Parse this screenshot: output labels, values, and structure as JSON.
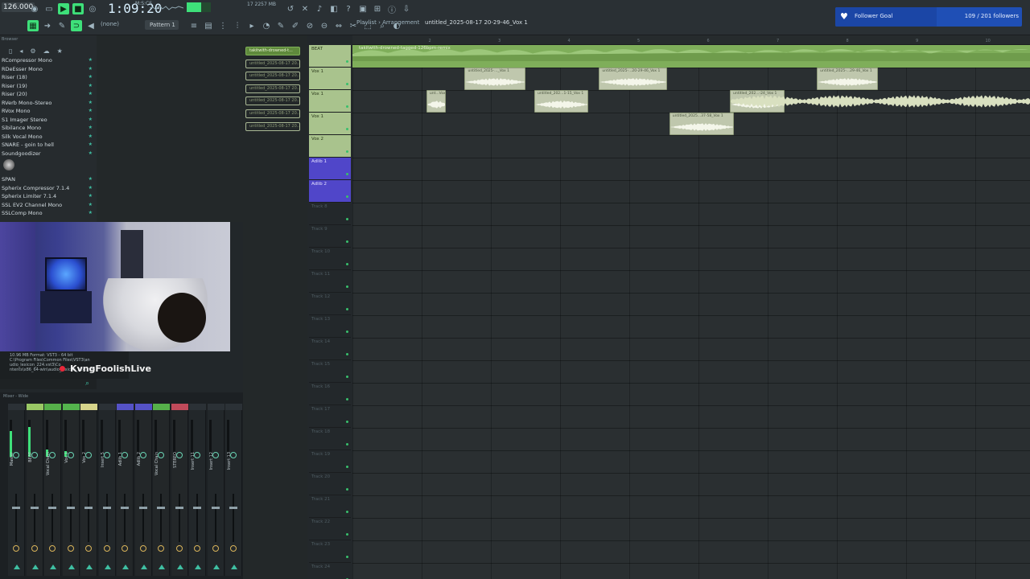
{
  "toolbar": {
    "bpm": "126.000",
    "song_time": "1:09:20",
    "time_unit": "M:S:CS",
    "memory": "17   2257 MB",
    "snap": "(none)",
    "pattern": "Pattern 1"
  },
  "playlist": {
    "label": "Playlist",
    "section": "Arrangement",
    "title": "untitled_2025-08-17 20-29-46_Vox 1",
    "ruler": [
      "2",
      "3",
      "4",
      "5",
      "6",
      "7",
      "8",
      "9",
      "10",
      "11"
    ]
  },
  "follower_goal": {
    "label": "Follower Goal",
    "count": "109 / 201 followers",
    "progress": 0.542,
    "color": "#1f4fb5"
  },
  "browser": {
    "header": "Browser",
    "plugins": [
      "RCompressor Mono",
      "RDeEsser Mono",
      "Riser (18)",
      "Riser (19)",
      "Riser (20)",
      "RVerb Mono-Stereo",
      "RVox Mono",
      "S1 Imager Stereo",
      "Sibilance Mono",
      "Silk Vocal Mono",
      "SNARE - goin to hell",
      "Soundgoodizer"
    ],
    "plugins2": [
      "SPAN",
      "Spherix Compressor 7.1.4",
      "Spherix Limiter 7.1.4",
      "SSL EV2 Channel Mono",
      "SSLComp Mono"
    ],
    "info": [
      "10.96 MB    Format: VST3 - 64 bit",
      "C:\\Program Files\\Common Files\\VST3\\an",
      "udio_lexicon_224.vst3\\Co",
      "ntents\\x86_64-win\\audio_lexicon_224.vst3"
    ]
  },
  "stream": {
    "name": "KvngFoolishLive"
  },
  "picker": {
    "items": [
      "takitwith-drowned-t...",
      "untitled_2025-08-17 20...",
      "untitled_2025-08-17 20...",
      "untitled_2025-08-17 20...",
      "untitled_2025-08-17 20...",
      "untitled_2025-08-17 20...",
      "untitled_2025-08-17 20..."
    ]
  },
  "tracks": [
    {
      "name": "BEAT",
      "style": "green"
    },
    {
      "name": "Vox 1",
      "style": "green"
    },
    {
      "name": "Vox 1",
      "style": "green"
    },
    {
      "name": "Vox 1",
      "style": "green"
    },
    {
      "name": "Vox 2",
      "style": "green"
    },
    {
      "name": "Adlib 1",
      "style": "purple"
    },
    {
      "name": "Adlib 2",
      "style": "purple"
    },
    {
      "name": "Track 8",
      "style": "empty"
    },
    {
      "name": "Track 9",
      "style": "empty"
    },
    {
      "name": "Track 10",
      "style": "empty"
    },
    {
      "name": "Track 11",
      "style": "empty"
    },
    {
      "name": "Track 12",
      "style": "empty"
    },
    {
      "name": "Track 13",
      "style": "empty"
    },
    {
      "name": "Track 14",
      "style": "empty"
    },
    {
      "name": "Track 15",
      "style": "empty"
    },
    {
      "name": "Track 16",
      "style": "empty"
    },
    {
      "name": "Track 17",
      "style": "empty"
    },
    {
      "name": "Track 18",
      "style": "empty"
    },
    {
      "name": "Track 19",
      "style": "empty"
    },
    {
      "name": "Track 20",
      "style": "empty"
    },
    {
      "name": "Track 21",
      "style": "empty"
    },
    {
      "name": "Track 22",
      "style": "empty"
    },
    {
      "name": "Track 23",
      "style": "empty"
    },
    {
      "name": "Track 24",
      "style": "empty"
    }
  ],
  "beat_clip": "takitwith-drowned-tagged-126bpm-remix",
  "clips": [
    {
      "title": "untitled_2025-..._Vox 1",
      "bar": 1.52,
      "len": 0.87,
      "row": 1
    },
    {
      "title": "untitled_2025-...20-29-46_Vox 1",
      "bar": 3.45,
      "len": 0.98,
      "row": 1
    },
    {
      "title": "untitled_2025-...29-46_Vox 1",
      "bar": 6.58,
      "len": 0.88,
      "row": 1
    },
    {
      "title": "unt...Vox 1",
      "bar": 0.97,
      "len": 0.28,
      "row": 2
    },
    {
      "title": "untitled_202...1-15_Vox 1",
      "bar": 2.52,
      "len": 0.77,
      "row": 2
    },
    {
      "title": "untitled_202...-24_Vox 1",
      "bar": 5.33,
      "len": 0.78,
      "row": 2
    },
    {
      "title": "untitled_2025...37-58_Vox 1",
      "bar": 4.46,
      "len": 0.93,
      "row": 3
    }
  ],
  "mixer": {
    "header": "Mixer - Wide",
    "strips": [
      {
        "name": "Master",
        "color": "#2b3136",
        "level": 0.7
      },
      {
        "name": "BEAT",
        "color": "#9ac865",
        "level": 0.8
      },
      {
        "name": "Vocal Chain",
        "color": "#56b04a",
        "level": 0.2
      },
      {
        "name": "Vox 1",
        "color": "#54b44d",
        "level": 0.15
      },
      {
        "name": "Vox 2",
        "color": "#d6d48a",
        "level": 0
      },
      {
        "name": "Insert 5",
        "color": "#2b3136",
        "level": 0
      },
      {
        "name": "Adlib 1",
        "color": "#5552c6",
        "level": 0
      },
      {
        "name": "Adlib 2",
        "color": "#5552c6",
        "level": 0
      },
      {
        "name": "Vocal Chain",
        "color": "#56b04a",
        "level": 0
      },
      {
        "name": "STEREO",
        "color": "#c04a5a",
        "level": 0
      },
      {
        "name": "Insert 11",
        "color": "#2b3136",
        "level": 0
      },
      {
        "name": "Insert 12",
        "color": "#2b3136",
        "level": 0
      },
      {
        "name": "Insert 13",
        "color": "#2b3136",
        "level": 0
      }
    ]
  },
  "icons": [
    "record-icon",
    "play-icon",
    "stop-icon",
    "pattern-icon",
    "song-icon",
    "metronome-icon",
    "undo-icon",
    "save-icon",
    "help-icon",
    "plugin-icon",
    "browser-icon",
    "star-icon",
    "search-icon",
    "magnet-icon",
    "pencil-icon",
    "brush-icon",
    "delete-icon",
    "mute-icon",
    "slice-icon",
    "select-icon",
    "zoom-icon",
    "speaker-icon"
  ]
}
